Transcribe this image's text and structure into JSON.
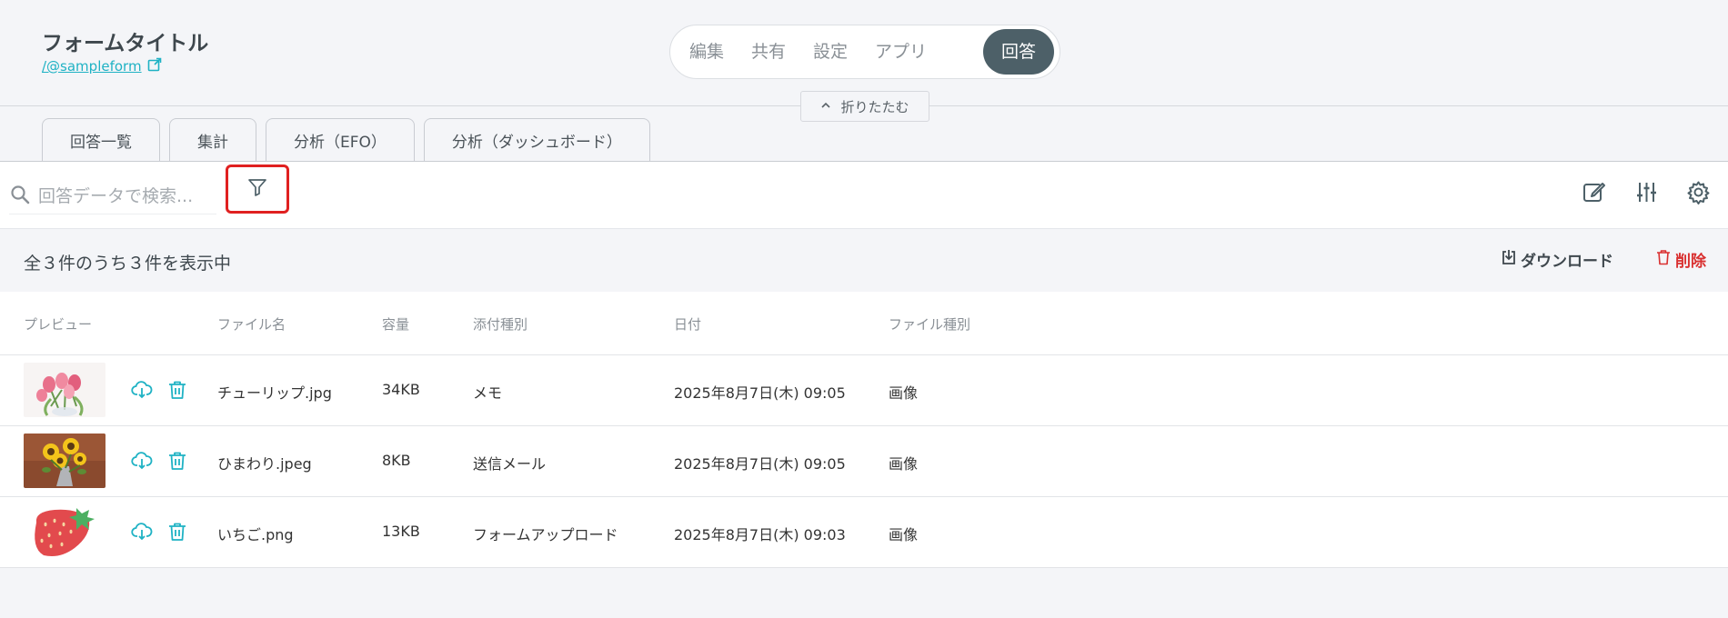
{
  "header": {
    "form_title": "フォームタイトル",
    "form_link": "/@sampleform",
    "nav": [
      "編集",
      "共有",
      "設定",
      "アプリ"
    ],
    "nav_active": "回答",
    "collapse_label": "折りたたむ"
  },
  "tabs": [
    "回答一覧",
    "集計",
    "分析（EFO）",
    "分析（ダッシュボード）"
  ],
  "toolbar": {
    "search_placeholder": "回答データで検索..."
  },
  "summary": {
    "text": "全３件のうち３件を表示中",
    "download_label": "ダウンロード",
    "delete_label": "削除"
  },
  "table": {
    "headers": {
      "preview": "プレビュー",
      "name": "ファイル名",
      "size": "容量",
      "attach_type": "添付種別",
      "date": "日付",
      "file_kind": "ファイル種別"
    },
    "rows": [
      {
        "name": "チューリップ.jpg",
        "size": "34KB",
        "attach_type": "メモ",
        "date": "2025年8月7日(木) 09:05",
        "file_kind": "画像"
      },
      {
        "name": "ひまわり.jpeg",
        "size": "8KB",
        "attach_type": "送信メール",
        "date": "2025年8月7日(木) 09:05",
        "file_kind": "画像"
      },
      {
        "name": "いちご.png",
        "size": "13KB",
        "attach_type": "フォームアップロード",
        "date": "2025年8月7日(木) 09:03",
        "file_kind": "画像"
      }
    ]
  },
  "colors": {
    "accent": "#1fb2c4",
    "nav_active_bg": "#4d6068",
    "delete": "#d93030",
    "highlight_border": "#e02020"
  }
}
